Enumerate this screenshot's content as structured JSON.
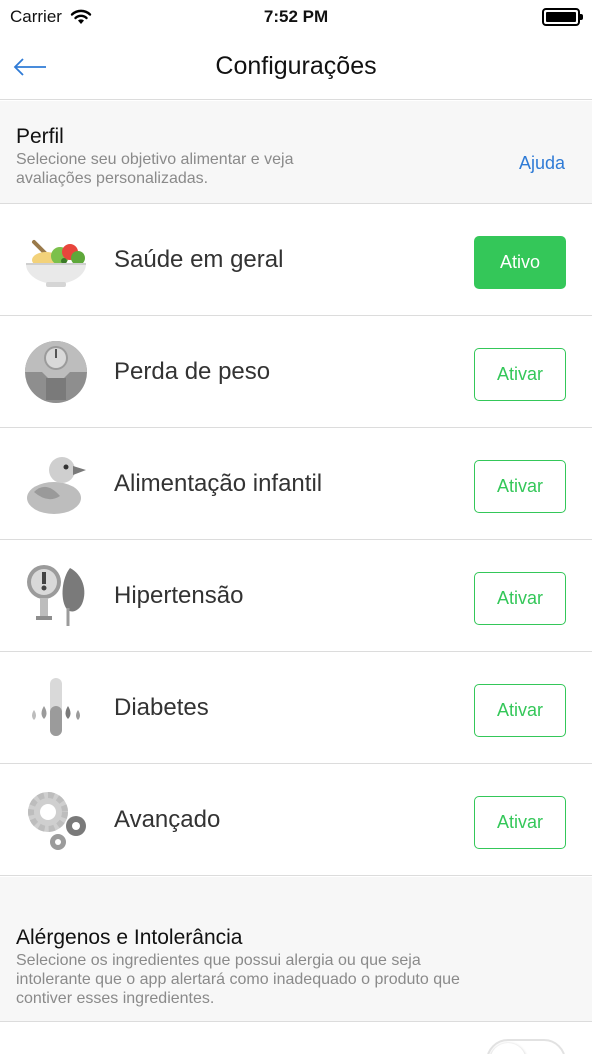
{
  "status_bar": {
    "carrier": "Carrier",
    "time": "7:52 PM"
  },
  "nav": {
    "title": "Configurações"
  },
  "perfil": {
    "title": "Perfil",
    "description_line1": "Selecione seu objetivo alimentar e veja",
    "description_line2": "avaliações personalizadas.",
    "help_label": "Ajuda"
  },
  "profiles": [
    {
      "label": "Saúde em geral",
      "button": "Ativo",
      "active": true,
      "icon": "salad-bowl-icon"
    },
    {
      "label": "Perda de peso",
      "button": "Ativar",
      "active": false,
      "icon": "scale-icon"
    },
    {
      "label": "Alimentação infantil",
      "button": "Ativar",
      "active": false,
      "icon": "rubber-duck-icon"
    },
    {
      "label": "Hipertensão",
      "button": "Ativar",
      "active": false,
      "icon": "blood-pressure-icon"
    },
    {
      "label": "Diabetes",
      "button": "Ativar",
      "active": false,
      "icon": "test-tube-drops-icon"
    },
    {
      "label": "Avançado",
      "button": "Ativar",
      "active": false,
      "icon": "gears-icon"
    }
  ],
  "allergens": {
    "title": "Alérgenos e Intolerância",
    "description_line1": "Selecione os ingredientes que possui alergia ou que seja",
    "description_line2": "intolerante que o app alertará como inadequado o produto que",
    "description_line3": "contiver esses ingredientes."
  },
  "colors": {
    "accent_green": "#34c759",
    "link_blue": "#2f7bd6",
    "section_bg": "#f7f7f7"
  }
}
